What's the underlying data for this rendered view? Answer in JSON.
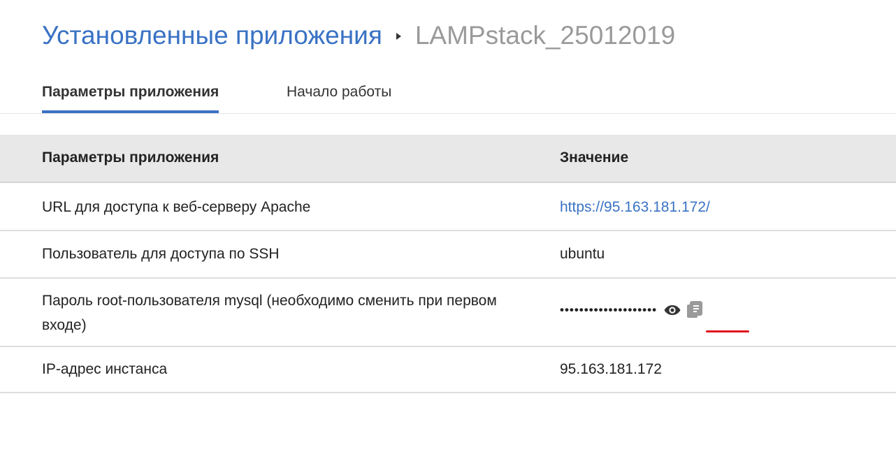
{
  "breadcrumb": {
    "parent": "Установленные приложения",
    "current": "LAMPstack_25012019"
  },
  "tabs": [
    {
      "label": "Параметры приложения",
      "active": true
    },
    {
      "label": "Начало работы",
      "active": false
    }
  ],
  "table": {
    "headers": {
      "name": "Параметры приложения",
      "value": "Значение"
    },
    "rows": [
      {
        "name": "URL для доступа к веб-серверу Apache",
        "value": "https://95.163.181.172/"
      },
      {
        "name": "Пользователь для доступа по SSH",
        "value": "ubuntu"
      },
      {
        "name": "Пароль root-пользователя mysql (необходимо сменить при первом входе)",
        "value": "••••••••••••••••••••"
      },
      {
        "name": "IP-адрес инстанса",
        "value": "95.163.181.172"
      }
    ]
  },
  "icons": {
    "show_password": "eye-icon",
    "copy_password": "copy-icon"
  },
  "colors": {
    "accent": "#3a72c4",
    "highlight": "#e0141e",
    "header_bg": "#e8e8e8",
    "muted_text": "#9a9a9a"
  }
}
